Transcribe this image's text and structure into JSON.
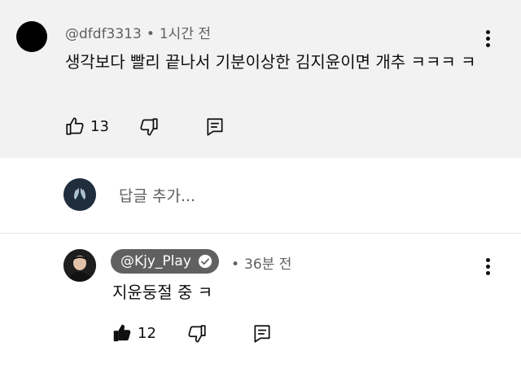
{
  "comment1": {
    "author": "@dfdf3313",
    "time": "1시간 전",
    "text": "생각보다 빨리 끝나서 기분이상한 김지윤이면 개추 ㅋㅋㅋ ㅋ",
    "likes": "13",
    "icons": [
      "thumbs-up-outline",
      "thumbs-down-outline",
      "reply-comment",
      "more-vert"
    ]
  },
  "reply_input": {
    "placeholder": "답글 추가..."
  },
  "comment2": {
    "author": "@Kjy_Play",
    "time": "36분 전",
    "text": "지윤둥절 중 ㅋ",
    "likes": "12",
    "verified": true,
    "icons": [
      "thumbs-up-filled",
      "thumbs-down-outline",
      "reply-comment",
      "more-vert",
      "verified-check"
    ]
  },
  "colors": {
    "highlight_bg": "#f2f2f2",
    "meta_text": "#606060",
    "chip_bg": "#606060"
  }
}
